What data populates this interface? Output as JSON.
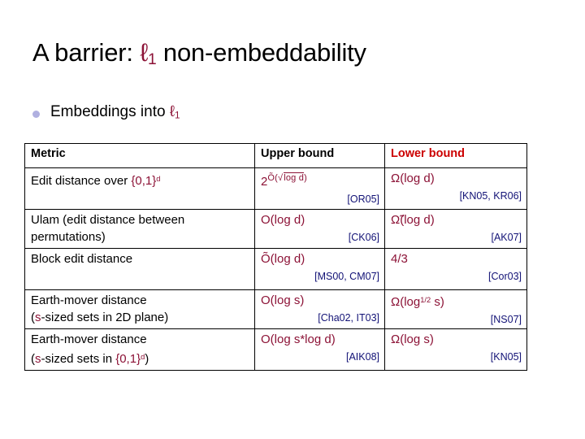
{
  "slide": {
    "title_prefix": "A barrier: ",
    "title_symbol": "ℓ",
    "title_symbol_sub": "1",
    "title_suffix": " non-embeddability",
    "title_plain": "A barrier: ℓ1 non-embeddability"
  },
  "bullet": {
    "icon": "bullet-dot-icon",
    "text_prefix": "Embeddings into ",
    "text_symbol": "ℓ",
    "text_symbol_sub": "1",
    "text_plain": "Embeddings into ℓ1"
  },
  "table": {
    "headers": {
      "metric": "Metric",
      "upper": "Upper bound",
      "lower": "Lower bound"
    },
    "header_colors": {
      "metric": "#000000",
      "upper": "#000000",
      "lower": "#cc0000"
    },
    "accent_colors": {
      "value": "#8c1236",
      "citation": "#121276",
      "bullet": "#b0b0e0"
    },
    "rows": [
      {
        "metric_line1": "Edit distance over ",
        "metric_line1_accent": "{0,1}",
        "metric_line1_accent_sup": "d",
        "metric_line2": "",
        "metric_plain": "Edit distance over {0,1}d",
        "upper_value": "2Õ(√log d)",
        "upper_value_base": "2",
        "upper_value_exp_prefix": "Õ(",
        "upper_value_exp_radicand": "log d",
        "upper_value_exp_suffix": ")",
        "upper_cite": "[OR05]",
        "lower_value": "Ω(log d)",
        "lower_cite": "[KN05, KR06]"
      },
      {
        "metric_line1": "Ulam (edit distance between",
        "metric_line2": "permutations)",
        "metric_plain": "Ulam (edit distance between permutations)",
        "upper_value": "O(log d)",
        "upper_cite": "[CK06]",
        "lower_value": "Ω̃(log d)",
        "lower_cite": "[AK07]"
      },
      {
        "metric_line1": "Block edit distance",
        "metric_line2": "",
        "metric_plain": "Block edit distance",
        "upper_value": "Õ(log d)",
        "upper_cite": "[MS00, CM07]",
        "lower_value": "4/3",
        "lower_cite": "[Cor03]"
      },
      {
        "metric_line1": "Earth-mover distance",
        "metric_line2_prefix": "(",
        "metric_line2_accent": "s",
        "metric_line2_suffix": "-sized sets in 2D plane)",
        "metric_plain": "Earth-mover distance (s-sized sets in 2D plane)",
        "upper_value": "O(log s)",
        "upper_cite": "[Cha02, IT03]",
        "lower_value_prefix": "Ω(log",
        "lower_value_sup": "1/2",
        "lower_value_suffix": " s)",
        "lower_value": "Ω(log1/2 s)",
        "lower_cite": "[NS07]"
      },
      {
        "metric_line1": "Earth-mover distance",
        "metric_line2_prefix": "(",
        "metric_line2_accent": "s",
        "metric_line2_suffix": "-sized sets in ",
        "metric_line2_accent2": "{0,1}",
        "metric_line2_accent2_sup": "d",
        "metric_line2_tail": ")",
        "metric_plain": "Earth-mover distance (s-sized sets in {0,1}d)",
        "upper_value": "O(log s*log d)",
        "upper_cite": "[AIK08]",
        "lower_value": "Ω(log s)",
        "lower_cite": "[KN05]"
      }
    ]
  }
}
